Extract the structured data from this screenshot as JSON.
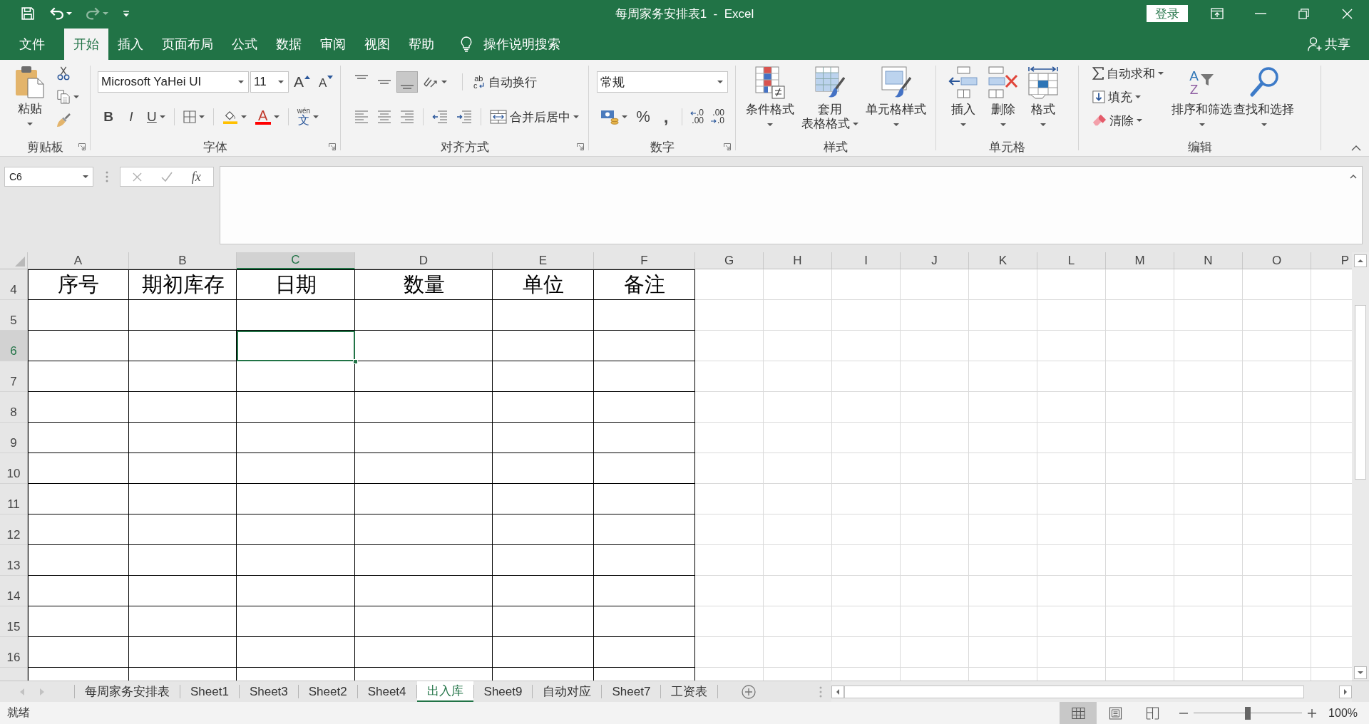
{
  "window": {
    "title": "每周家务安排表1  -  Excel",
    "sign_in": "登录"
  },
  "tabs": [
    {
      "label": "文件",
      "selected": false
    },
    {
      "label": "开始",
      "selected": true
    },
    {
      "label": "插入",
      "selected": false
    },
    {
      "label": "页面布局",
      "selected": false
    },
    {
      "label": "公式",
      "selected": false
    },
    {
      "label": "数据",
      "selected": false
    },
    {
      "label": "审阅",
      "selected": false
    },
    {
      "label": "视图",
      "selected": false
    },
    {
      "label": "帮助",
      "selected": false
    }
  ],
  "tell_me": "操作说明搜索",
  "share": "共享",
  "clipboard": {
    "label": "剪贴板",
    "paste": "粘贴"
  },
  "font": {
    "label": "字体",
    "name": "Microsoft YaHei UI",
    "size": "11",
    "grow": "A",
    "shrink": "A",
    "bold": "B",
    "italic": "I",
    "underline": "U",
    "font_color": "A",
    "phonetic": [
      "wén",
      "文"
    ]
  },
  "alignment": {
    "label": "对齐方式",
    "vertical": [
      {
        "kind": "top",
        "selected": false
      },
      {
        "kind": "middle",
        "selected": false
      },
      {
        "kind": "bottom",
        "selected": true
      }
    ],
    "wrap_icon": [
      "ab",
      "c"
    ],
    "wrap": "自动换行",
    "merge": "合并后居中"
  },
  "number": {
    "label": "数字",
    "format": "常规",
    "percent": "%",
    "comma": ",",
    "increase_decimal": [
      ".0",
      ".00"
    ],
    "decrease_decimal": [
      ".00",
      ".0"
    ]
  },
  "styles": {
    "label": "样式",
    "conditional": "条件格式",
    "format_table": [
      "套用",
      "表格格式"
    ],
    "cell_styles": "单元格样式"
  },
  "cells": {
    "label": "单元格",
    "insert": "插入",
    "delete": "删除",
    "format": "格式"
  },
  "editing": {
    "label": "编辑",
    "autosum": "自动求和",
    "fill": "填充",
    "clear": "清除",
    "sort_icon": [
      "A",
      "Z"
    ],
    "sort_filter": "排序和筛选",
    "find_select": "查找和选择"
  },
  "formula_bar": {
    "name_box": "C6",
    "function": "fx"
  },
  "columns": [
    {
      "label": "A",
      "selected": false,
      "bordered": true
    },
    {
      "label": "B",
      "selected": false,
      "bordered": true
    },
    {
      "label": "C",
      "selected": true,
      "bordered": true
    },
    {
      "label": "D",
      "selected": false,
      "bordered": true
    },
    {
      "label": "E",
      "selected": false,
      "bordered": true
    },
    {
      "label": "F",
      "selected": false,
      "bordered": true
    },
    {
      "label": "G",
      "selected": false,
      "bordered": false
    },
    {
      "label": "H",
      "selected": false,
      "bordered": false
    },
    {
      "label": "I",
      "selected": false,
      "bordered": false
    },
    {
      "label": "J",
      "selected": false,
      "bordered": false
    },
    {
      "label": "K",
      "selected": false,
      "bordered": false
    },
    {
      "label": "L",
      "selected": false,
      "bordered": false
    },
    {
      "label": "M",
      "selected": false,
      "bordered": false
    },
    {
      "label": "N",
      "selected": false,
      "bordered": false
    },
    {
      "label": "O",
      "selected": false,
      "bordered": false
    },
    {
      "label": "P",
      "selected": false,
      "bordered": false
    }
  ],
  "rows": [
    {
      "number": "4",
      "selected": false,
      "cells": [
        "序号",
        "期初库存",
        "日期",
        "数量",
        "单位",
        "备注"
      ]
    },
    {
      "number": "5",
      "selected": false
    },
    {
      "number": "6",
      "selected": true
    },
    {
      "number": "7",
      "selected": false
    },
    {
      "number": "8",
      "selected": false
    },
    {
      "number": "9",
      "selected": false
    },
    {
      "number": "10",
      "selected": false
    },
    {
      "number": "11",
      "selected": false
    },
    {
      "number": "12",
      "selected": false
    },
    {
      "number": "13",
      "selected": false
    },
    {
      "number": "14",
      "selected": false
    },
    {
      "number": "15",
      "selected": false
    },
    {
      "number": "16",
      "selected": false
    }
  ],
  "sheet_tabs": [
    {
      "label": "每周家务安排表",
      "selected": false
    },
    {
      "label": "Sheet1",
      "selected": false
    },
    {
      "label": "Sheet3",
      "selected": false
    },
    {
      "label": "Sheet2",
      "selected": false
    },
    {
      "label": "Sheet4",
      "selected": false
    },
    {
      "label": "出入库",
      "selected": true
    },
    {
      "label": "Sheet9",
      "selected": false
    },
    {
      "label": "自动对应",
      "selected": false
    },
    {
      "label": "Sheet7",
      "selected": false
    },
    {
      "label": "工资表",
      "selected": false
    }
  ],
  "status_bar": {
    "text": "就绪",
    "views": [
      {
        "kind": "normal",
        "selected": true
      },
      {
        "kind": "page_layout",
        "selected": false
      },
      {
        "kind": "page_break",
        "selected": false
      }
    ],
    "zoom_slider": {
      "level": 0.5
    },
    "zoom": "100%"
  }
}
